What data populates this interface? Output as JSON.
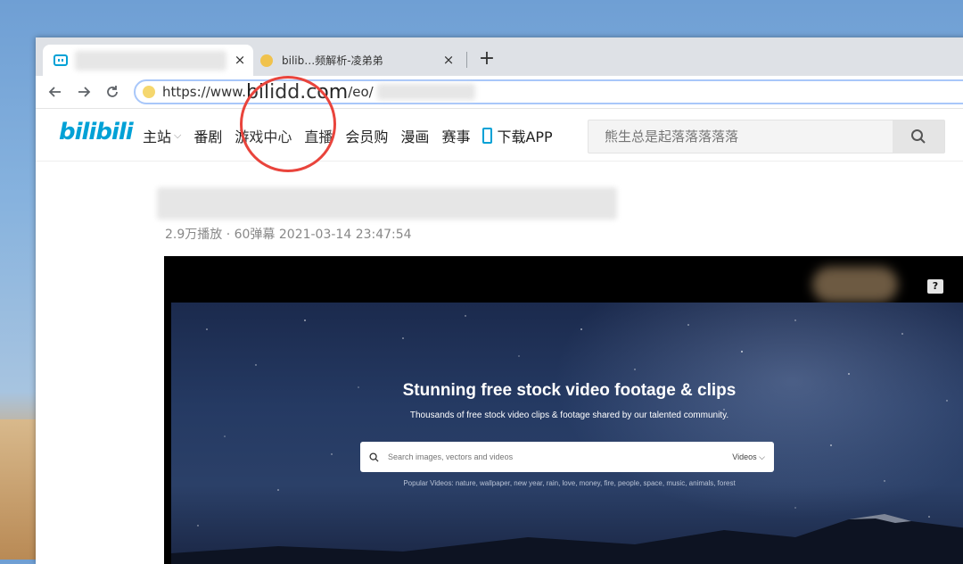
{
  "browser": {
    "tabs": [
      {
        "title": "",
        "close": "×"
      },
      {
        "title": "bilib…频解析-凌弟弟",
        "close": "×"
      }
    ],
    "new_tab": "+",
    "url_prefix": "https://www.",
    "url_domain": "bilidd.com",
    "url_path": "/eo/"
  },
  "bili": {
    "logo": "bilibili",
    "nav": [
      "主站",
      "番剧",
      "游戏中心",
      "直播",
      "会员购",
      "漫画",
      "赛事",
      "下载APP"
    ],
    "search_placeholder": "熊生总是起落落落落落"
  },
  "video": {
    "meta": "2.9万播放 · 60弹幕   2021-03-14 23:47:54"
  },
  "player": {
    "help": "?",
    "hero_title": "Stunning free stock video footage & clips",
    "hero_subtitle": "Thousands of free stock video clips & footage shared by our talented community.",
    "search_placeholder": "Search images, vectors and videos",
    "search_type": "Videos",
    "popular": "Popular Videos: nature, wallpaper, new year, rain, love, money, fire, people, space, music, animals, forest"
  },
  "colors": {
    "bili_blue": "#00a1d6",
    "highlight_ring": "#e9443c"
  }
}
